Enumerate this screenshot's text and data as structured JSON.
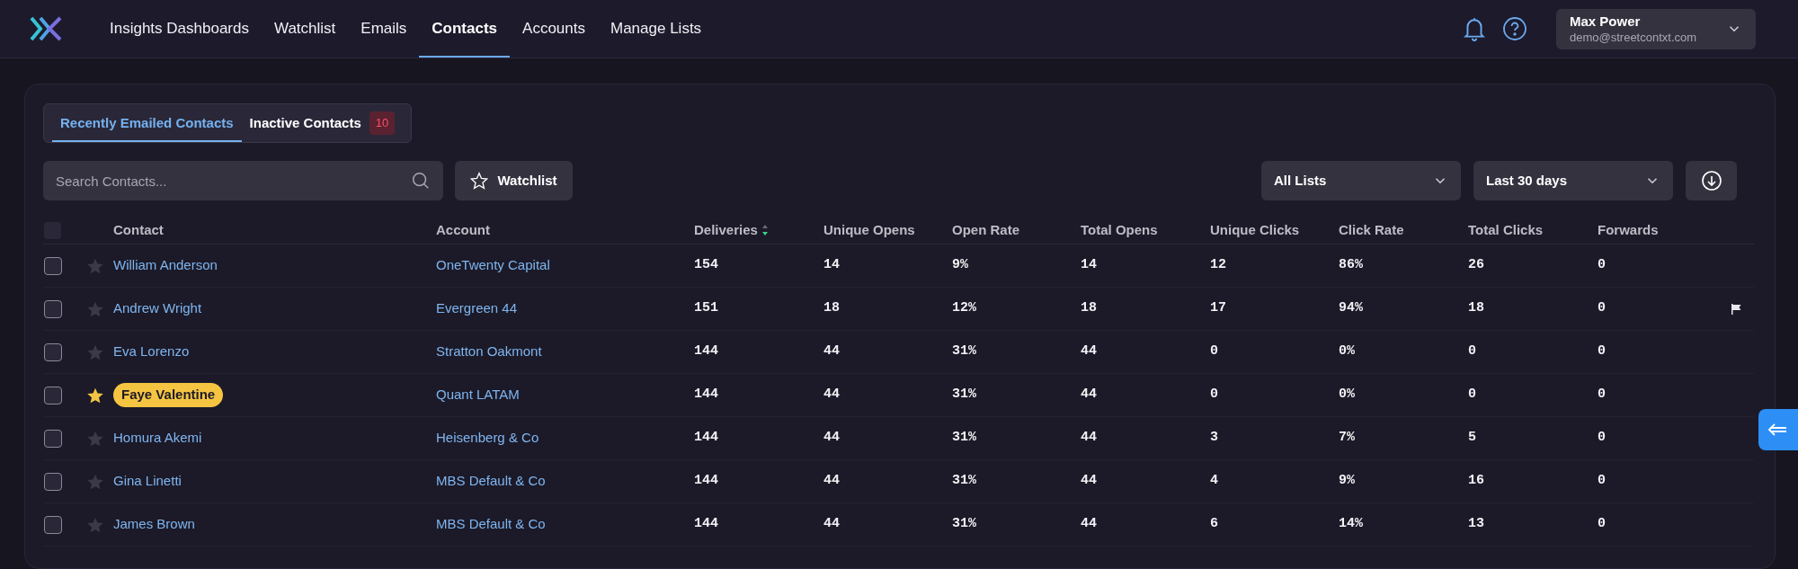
{
  "nav": {
    "items": [
      {
        "label": "Insights Dashboards",
        "selected": false
      },
      {
        "label": "Watchlist",
        "selected": false
      },
      {
        "label": "Emails",
        "selected": false
      },
      {
        "label": "Contacts",
        "selected": true
      },
      {
        "label": "Accounts",
        "selected": false
      },
      {
        "label": "Manage Lists",
        "selected": false
      }
    ],
    "user": {
      "name": "Max Power",
      "email": "demo@streetcontxt.com"
    }
  },
  "tabs": [
    {
      "label": "Recently Emailed Contacts",
      "selected": true
    },
    {
      "label": "Inactive Contacts",
      "selected": false,
      "badge": "10"
    }
  ],
  "search": {
    "placeholder": "Search Contacts..."
  },
  "watchlist_button": "Watchlist",
  "filters": [
    {
      "value": "All Lists"
    },
    {
      "value": "Last 30 days"
    }
  ],
  "table": {
    "select_all_checked": false,
    "columns": [
      {
        "label": "Contact",
        "sorted": false
      },
      {
        "label": "Account",
        "sorted": false
      },
      {
        "label": "Deliveries",
        "sorted": true
      },
      {
        "label": "Unique Opens",
        "sorted": false
      },
      {
        "label": "Open Rate",
        "sorted": false
      },
      {
        "label": "Total Opens",
        "sorted": false
      },
      {
        "label": "Unique Clicks",
        "sorted": false
      },
      {
        "label": "Click Rate",
        "sorted": false
      },
      {
        "label": "Total Clicks",
        "sorted": false
      },
      {
        "label": "Forwards",
        "sorted": false
      }
    ],
    "rows": [
      {
        "checked": false,
        "starred": false,
        "highlighted": false,
        "flagged": false,
        "contact": "William Anderson",
        "account": "OneTwenty Capital",
        "values": [
          "154",
          "14",
          "9%",
          "14",
          "12",
          "86%",
          "26",
          "0"
        ]
      },
      {
        "checked": false,
        "starred": false,
        "highlighted": false,
        "flagged": true,
        "contact": "Andrew Wright",
        "account": "Evergreen 44",
        "values": [
          "151",
          "18",
          "12%",
          "18",
          "17",
          "94%",
          "18",
          "0"
        ]
      },
      {
        "checked": false,
        "starred": false,
        "highlighted": false,
        "flagged": false,
        "contact": "Eva Lorenzo",
        "account": "Stratton Oakmont",
        "values": [
          "144",
          "44",
          "31%",
          "44",
          "0",
          "0%",
          "0",
          "0"
        ]
      },
      {
        "checked": false,
        "starred": true,
        "highlighted": true,
        "flagged": false,
        "contact": "Faye Valentine",
        "account": "Quant LATAM",
        "values": [
          "144",
          "44",
          "31%",
          "44",
          "0",
          "0%",
          "0",
          "0"
        ]
      },
      {
        "checked": false,
        "starred": false,
        "highlighted": false,
        "flagged": false,
        "contact": "Homura Akemi",
        "account": "Heisenberg & Co",
        "values": [
          "144",
          "44",
          "31%",
          "44",
          "3",
          "7%",
          "5",
          "0"
        ]
      },
      {
        "checked": false,
        "starred": false,
        "highlighted": false,
        "flagged": false,
        "contact": "Gina Linetti",
        "account": "MBS Default & Co",
        "values": [
          "144",
          "44",
          "31%",
          "44",
          "4",
          "9%",
          "16",
          "0"
        ]
      },
      {
        "checked": false,
        "starred": false,
        "highlighted": false,
        "flagged": false,
        "contact": "James Brown",
        "account": "MBS Default & Co",
        "values": [
          "144",
          "44",
          "31%",
          "44",
          "6",
          "14%",
          "13",
          "0"
        ]
      }
    ]
  }
}
